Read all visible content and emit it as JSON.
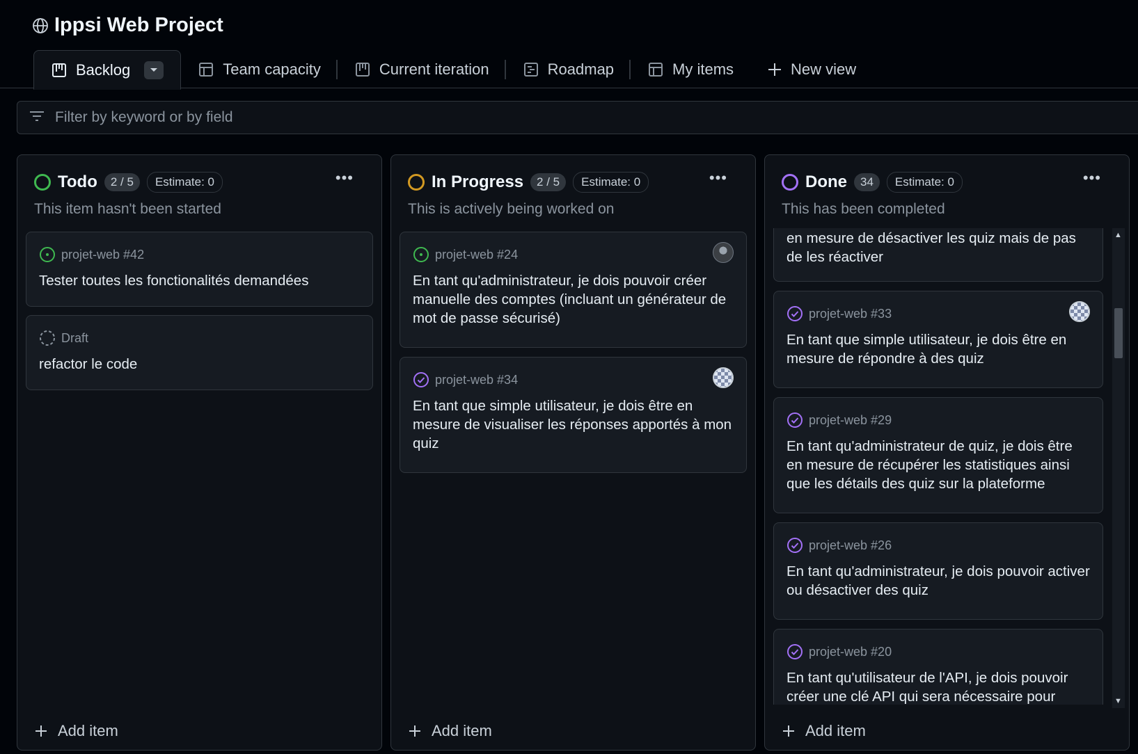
{
  "project": {
    "title": "Ippsi Web Project",
    "icon": "globe-icon"
  },
  "tabs": [
    {
      "label": "Backlog",
      "icon": "board-icon",
      "active": true
    },
    {
      "label": "Team capacity",
      "icon": "table-icon"
    },
    {
      "label": "Current iteration",
      "icon": "board-icon"
    },
    {
      "label": "Roadmap",
      "icon": "roadmap-icon"
    },
    {
      "label": "My items",
      "icon": "table-icon"
    },
    {
      "label": "New view",
      "icon": "plus-icon"
    }
  ],
  "filter": {
    "placeholder": "Filter by keyword or by field",
    "value": ""
  },
  "columns": {
    "todo": {
      "name": "Todo",
      "count": "2 / 5",
      "estimate": "Estimate: 0",
      "description": "This item hasn't been started",
      "color": "#3fb950",
      "add_label": "Add item",
      "cards": [
        {
          "meta": "projet-web #42",
          "icon": "issue-open-icon",
          "title": "Tester toutes les fonctionalités demandées"
        },
        {
          "meta": "Draft",
          "icon": "issue-draft-icon",
          "title": "refactor le code"
        }
      ]
    },
    "progress": {
      "name": "In Progress",
      "count": "2 / 5",
      "estimate": "Estimate: 0",
      "description": "This is actively being worked on",
      "color": "#d29922",
      "add_label": "Add item",
      "cards": [
        {
          "meta": "projet-web #24",
          "icon": "issue-open-icon",
          "title": "En tant qu'administrateur, je dois pouvoir créer manuelle des comptes (incluant un générateur de mot de passe sécurisé)"
        },
        {
          "meta": "projet-web #34",
          "icon": "issue-closed-icon",
          "title": "En tant que simple utilisateur, je dois être en mesure de visualiser les réponses apportés à mon quiz"
        }
      ]
    },
    "done": {
      "name": "Done",
      "count": "34",
      "estimate": "Estimate: 0",
      "description": "This has been completed",
      "color": "#a371f7",
      "add_label": "Add item",
      "cards": [
        {
          "title": "en mesure de désactiver les quiz mais de pas de les réactiver"
        },
        {
          "meta": "projet-web #33",
          "icon": "issue-closed-icon",
          "title": "En tant que simple utilisateur, je dois être en mesure de répondre à des quiz"
        },
        {
          "meta": "projet-web #29",
          "icon": "issue-closed-icon",
          "title": "En tant qu'administrateur de quiz, je dois être en mesure de récupérer les statistiques ainsi que les détails des quiz sur la plateforme"
        },
        {
          "meta": "projet-web #26",
          "icon": "issue-closed-icon",
          "title": "En tant qu'administrateur, je dois pouvoir activer ou désactiver des quiz"
        },
        {
          "meta": "projet-web #20",
          "icon": "issue-closed-icon",
          "title": "En tant qu'utilisateur de l'API, je dois pouvoir créer une clé API qui sera nécessaire pour"
        }
      ]
    }
  }
}
